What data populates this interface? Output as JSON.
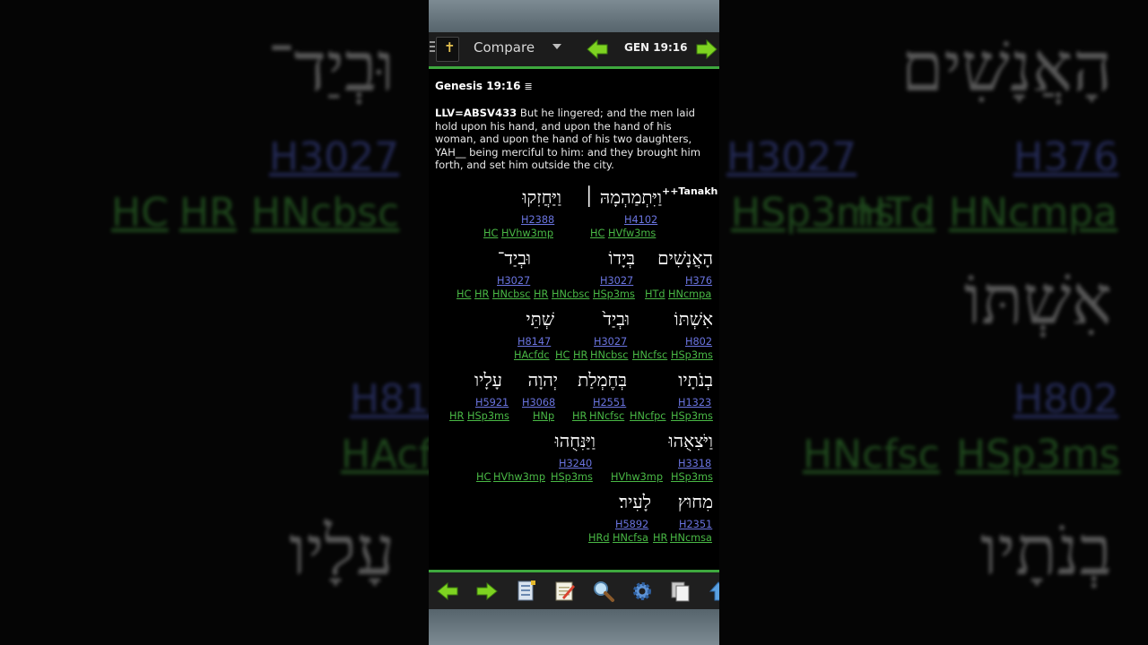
{
  "app": {
    "title": "Compare",
    "reference": "GEN 19:16",
    "colors": {
      "accent": "#3ea83e",
      "strongs": "#6a74e0",
      "morph": "#49b845",
      "status_bar": "#6b7980"
    }
  },
  "toolbar": {
    "icons": [
      "book-icon",
      "back-arrow-icon",
      "forward-arrow-icon"
    ]
  },
  "verse": {
    "heading": "Genesis 19:16",
    "heading_icon": "menu-lines-icon",
    "version_tag": "LLV=ABSV433",
    "text": "But he lingered; and the men laid hold upon his hand, and upon the hand of his woman, and upon the hand of his two daughters, YAH__ being merciful to him: and they brought him forth, and set him outside the city.",
    "tanakh_label": "++Tanakh"
  },
  "interlinear": [
    {
      "hebrew": "וַיִּתְמַהְמָהּ ׀",
      "strongs": "H4102",
      "morph": [
        "HC",
        "HVfw3ms"
      ]
    },
    {
      "hebrew": "וַיַּחֲזִקוּ",
      "strongs": "H2388",
      "morph": [
        "HC",
        "HVhw3mp"
      ]
    },
    {
      "hebrew": "הָאֲנָשִׁים",
      "strongs": "H376",
      "morph": [
        "HTd",
        "HNcmpa"
      ]
    },
    {
      "hebrew": "בְּיָדוֹ",
      "strongs": "H3027",
      "morph": [
        "HNcbsc",
        "HSp3ms"
      ]
    },
    {
      "hebrew": "וּבְיַד־",
      "strongs": "H3027",
      "morph": [
        "HC",
        "HR",
        "HNcbsc",
        "HR"
      ]
    },
    {
      "hebrew": "אִשְׁתּוֹ",
      "strongs": "H802",
      "morph": [
        "HNcfsc",
        "HSp3ms"
      ]
    },
    {
      "hebrew": "וּבְיַד֙",
      "strongs": "H3027",
      "morph": [
        "HC",
        "HR",
        "HNcbsc"
      ]
    },
    {
      "hebrew": "שְׁתֵּי",
      "strongs": "H8147",
      "morph": [
        "HAcfdc"
      ]
    },
    {
      "hebrew": "בְנֹתָיו",
      "strongs": "H1323",
      "morph": [
        "HNcfpc",
        "HSp3ms"
      ]
    },
    {
      "hebrew": "בְּחֶמְלַת",
      "strongs": "H2551",
      "morph": [
        "HR",
        "HNcfsc"
      ]
    },
    {
      "hebrew": "יְהוָה",
      "strongs": "H3068",
      "morph": [
        "HNp"
      ]
    },
    {
      "hebrew": "עָלָיו",
      "strongs": "H5921",
      "morph": [
        "HR",
        "HSp3ms"
      ]
    },
    {
      "hebrew": "וַיֹּצִאֻהוּ",
      "strongs": "H3318",
      "morph": [
        "HVhw3mp",
        "HSp3ms"
      ]
    },
    {
      "hebrew": "וַיַּנִּחֻהוּ",
      "strongs": "H3240",
      "morph": [
        "HC",
        "HVhw3mp",
        "HSp3ms"
      ]
    },
    {
      "hebrew": "מִחוּץ",
      "strongs": "H2351",
      "morph": [
        "HR",
        "HNcmsa"
      ]
    },
    {
      "hebrew": "לָעִיר׃",
      "strongs": "H5892",
      "morph": [
        "HRd",
        "HNcfsa"
      ]
    }
  ],
  "bottom_toolbar": {
    "icons": [
      "back-icon",
      "forward-icon",
      "bookmark-document-icon",
      "notes-icon",
      "search-icon",
      "settings-gear-icon",
      "copy-pages-icon",
      "up-arrow-icon"
    ]
  }
}
